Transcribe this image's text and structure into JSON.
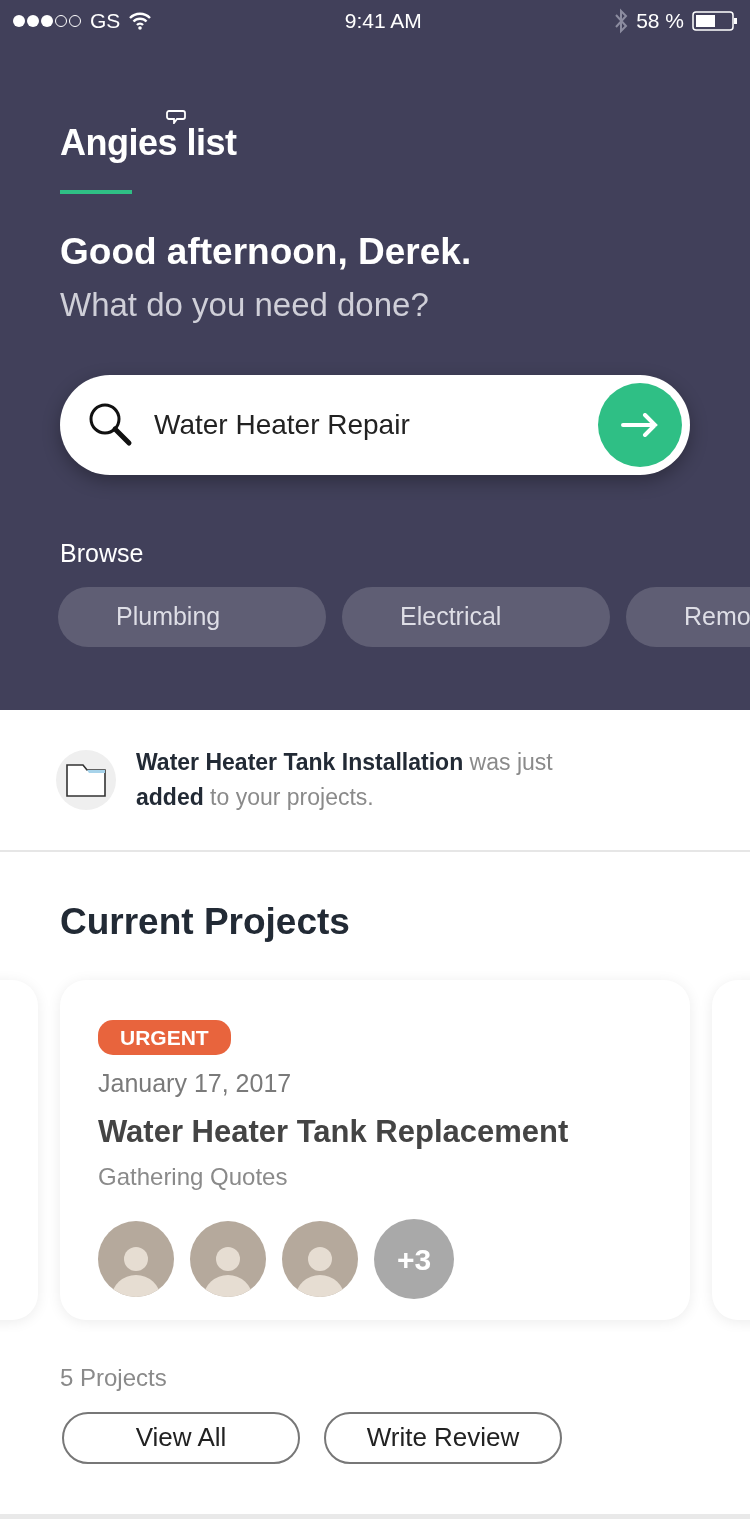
{
  "status_bar": {
    "carrier": "GS",
    "time": "9:41 AM",
    "battery_percent": "58 %"
  },
  "header": {
    "logo": "Angies list",
    "greeting": "Good afternoon, Derek.",
    "prompt": "What do you need done?"
  },
  "search": {
    "value": "Water Heater Repair"
  },
  "browse": {
    "label": "Browse",
    "categories": [
      "Plumbing",
      "Electrical",
      "Remo"
    ]
  },
  "notice": {
    "text": "**Water Heater Tank Installation** was just **added** to your projects."
  },
  "projects": {
    "title": "Current Projects",
    "cards": [
      {
        "tag": "URGENT",
        "date": "January 17, 2017",
        "name": "Water Heater Tank Replacement",
        "status": "Gathering Quotes",
        "avatars": [
          {
            "kind": "photo"
          },
          {
            "kind": "photo"
          },
          {
            "kind": "photo"
          }
        ],
        "more": "+3"
      }
    ],
    "count": "5 Projects",
    "buttons": [
      "View All",
      "Write Review"
    ]
  }
}
